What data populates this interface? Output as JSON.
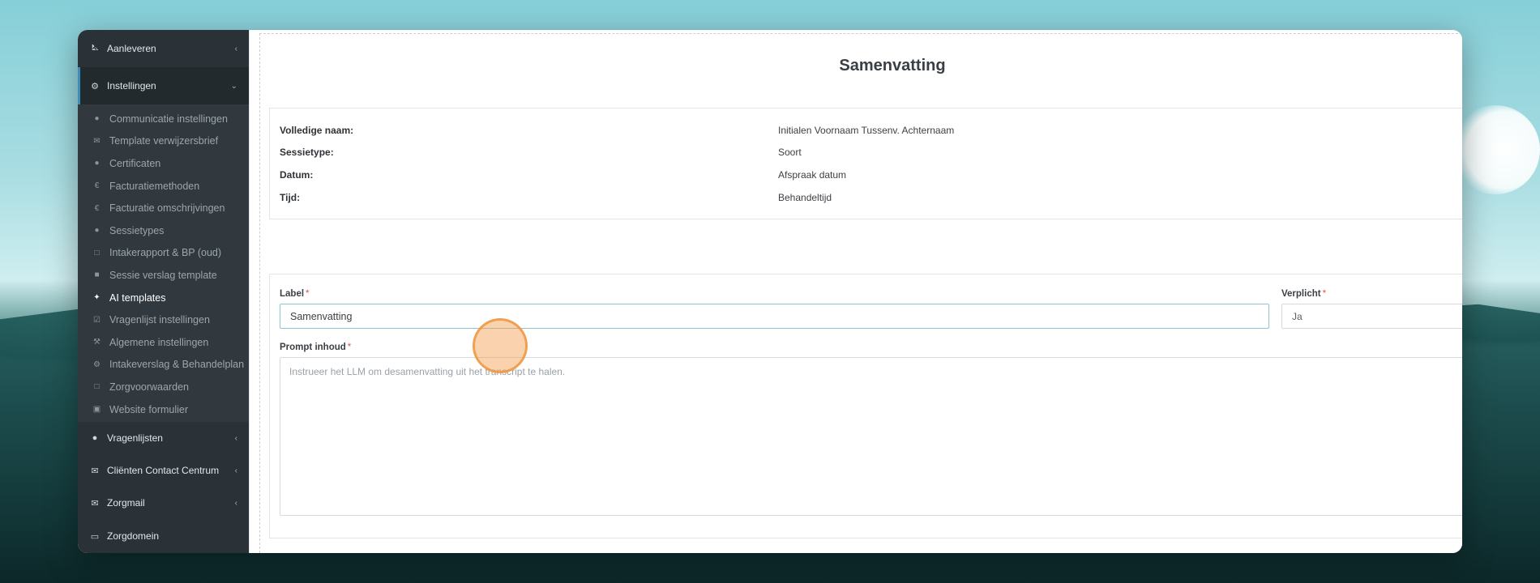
{
  "sidebar": {
    "top_items": [
      {
        "label": "Aanleveren",
        "icon": "truck-icon"
      },
      {
        "label": "Instellingen",
        "icon": "gear-icon"
      }
    ],
    "sub_items": [
      {
        "label": "Communicatie instellingen",
        "icon": "comments-icon"
      },
      {
        "label": "Template verwijzersbrief",
        "icon": "envelope-icon"
      },
      {
        "label": "Certificaten",
        "icon": "certificate-icon"
      },
      {
        "label": "Facturatiemethoden",
        "icon": "euro-icon"
      },
      {
        "label": "Facturatie omschrijvingen",
        "icon": "euro-icon"
      },
      {
        "label": "Sessietypes",
        "icon": "globe-icon"
      },
      {
        "label": "Intakerapport & BP (oud)",
        "icon": "file-icon"
      },
      {
        "label": "Sessie verslag template",
        "icon": "book-icon"
      },
      {
        "label": "AI templates",
        "icon": "magic-wand-icon",
        "current": true
      },
      {
        "label": "Vragenlijst instellingen",
        "icon": "checkbox-icon"
      },
      {
        "label": "Algemene instellingen",
        "icon": "wrench-icon"
      },
      {
        "label": "Intakeverslag & Behandelplan",
        "icon": "gear-icon"
      },
      {
        "label": "Zorgvoorwaarden",
        "icon": "pdf-file-icon"
      },
      {
        "label": "Website formulier",
        "icon": "medkit-icon"
      }
    ],
    "bottom_items": [
      {
        "label": "Vragenlijsten",
        "icon": "globe-icon"
      },
      {
        "label": "Cliënten Contact Centrum",
        "icon": "envelope-icon"
      },
      {
        "label": "Zorgmail",
        "icon": "envelope-icon"
      },
      {
        "label": "Zorgdomein",
        "icon": "inbox-icon"
      }
    ],
    "accent_color": "#3c8dbc"
  },
  "main": {
    "title": "Samenvatting",
    "summary": [
      {
        "key": "Volledige naam:",
        "value": "Initialen Voornaam Tussenv. Achternaam"
      },
      {
        "key": "Sessietype:",
        "value": "Soort"
      },
      {
        "key": "Datum:",
        "value": "Afspraak datum"
      },
      {
        "key": "Tijd:",
        "value": "Behandeltijd"
      }
    ],
    "form": {
      "label_label": "Label",
      "label_value": "Samenvatting",
      "verplicht_label": "Verplicht",
      "verplicht_value": "Ja",
      "prompt_label": "Prompt inhoud",
      "prompt_placeholder": "Instrueer het LLM om desamenvatting uit het transcript te halen.",
      "required_marker": "*"
    }
  }
}
